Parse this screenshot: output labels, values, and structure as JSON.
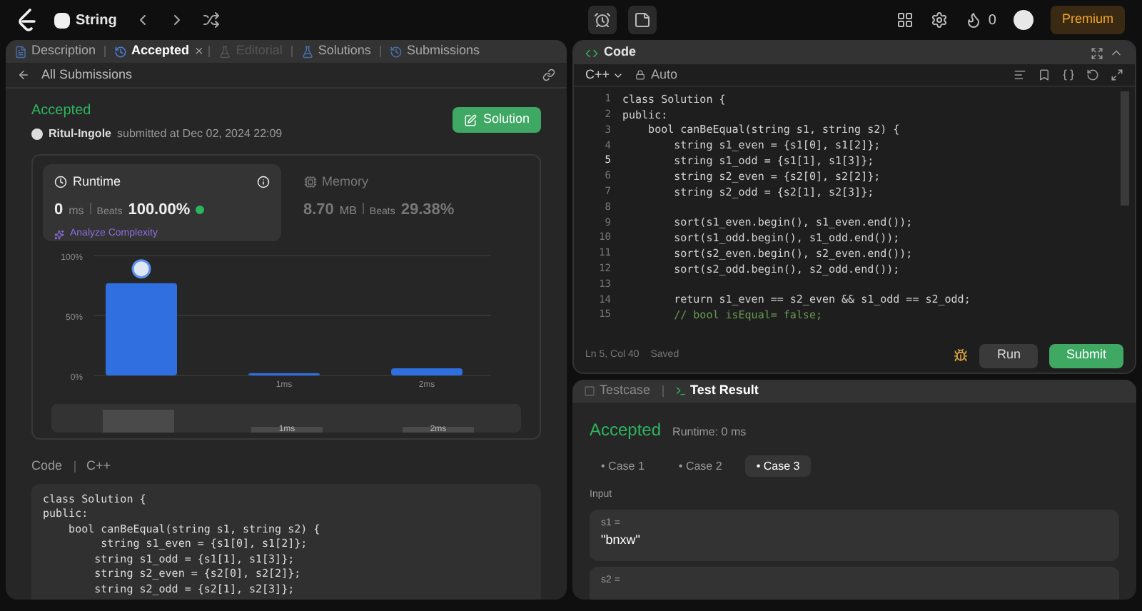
{
  "topbar": {
    "problem_list": "String",
    "flame_count": "0",
    "premium": "Premium"
  },
  "left_tabs": [
    {
      "label": "Description",
      "selected": false,
      "disabled": false
    },
    {
      "label": "Accepted",
      "selected": true,
      "disabled": false,
      "close": "×"
    },
    {
      "label": "Editorial",
      "selected": false,
      "disabled": true
    },
    {
      "label": "Solutions",
      "selected": false,
      "disabled": false
    },
    {
      "label": "Submissions",
      "selected": false,
      "disabled": false
    }
  ],
  "submission": {
    "back": "All Submissions",
    "status": "Accepted",
    "user": "Ritul-Ingole",
    "submitted": "submitted at Dec 02, 2024 22:09",
    "solution_button": "Solution"
  },
  "metrics": [
    {
      "kind": "runtime",
      "title": "Runtime",
      "value": "0",
      "unit": "ms",
      "beats_label": "Beats",
      "beats": "100.00%",
      "selected": true,
      "link": "Analyze Complexity"
    },
    {
      "kind": "memory",
      "title": "Memory",
      "value": "8.70",
      "unit": "MB",
      "beats_label": "Beats",
      "beats": "29.38%",
      "selected": false
    }
  ],
  "chart_data": {
    "type": "bar",
    "categories": [
      null,
      "1ms",
      "2ms"
    ],
    "values": [
      77,
      2,
      6
    ],
    "ylim": [
      0,
      100
    ],
    "yticks": [
      {
        "value": 0,
        "label": "0%"
      },
      {
        "value": 50,
        "label": "50%"
      },
      {
        "value": 100,
        "label": "100%"
      }
    ]
  },
  "navigator": {
    "labels": [
      "1ms",
      "2ms"
    ]
  },
  "code_preview": {
    "label": "Code",
    "language": "C++",
    "lines": [
      "class Solution {",
      "public:",
      "    bool canBeEqual(string s1, string s2) {",
      "         string s1_even = {s1[0], s1[2]};",
      "        string s1_odd = {s1[1], s1[3]};",
      "        string s2_even = {s2[0], s2[2]};",
      "        string s2_odd = {s2[1], s2[3]};"
    ]
  },
  "editor": {
    "title": "Code",
    "language": "C++",
    "mode": "Auto",
    "status": "Ln 5, Col 40",
    "saved": "Saved",
    "run": "Run",
    "submit": "Submit",
    "lines": [
      {
        "n": "1",
        "text": "class Solution {",
        "current": false,
        "kind": "code"
      },
      {
        "n": "2",
        "text": "public:",
        "current": false,
        "kind": "code"
      },
      {
        "n": "3",
        "text": "    bool canBeEqual(string s1, string s2) {",
        "current": false,
        "kind": "code"
      },
      {
        "n": "4",
        "text": "        string s1_even = {s1[0], s1[2]};",
        "current": false,
        "kind": "code"
      },
      {
        "n": "5",
        "text": "        string s1_odd = {s1[1], s1[3]};",
        "current": true,
        "kind": "code"
      },
      {
        "n": "6",
        "text": "        string s2_even = {s2[0], s2[2]};",
        "current": false,
        "kind": "code"
      },
      {
        "n": "7",
        "text": "        string s2_odd = {s2[1], s2[3]};",
        "current": false,
        "kind": "code"
      },
      {
        "n": "8",
        "current": false
      },
      {
        "n": "9",
        "text": "        sort(s1_even.begin(), s1_even.end());",
        "current": false,
        "kind": "code"
      },
      {
        "n": "10",
        "text": "        sort(s1_odd.begin(), s1_odd.end());",
        "current": false,
        "kind": "code"
      },
      {
        "n": "11",
        "text": "        sort(s2_even.begin(), s2_even.end());",
        "current": false,
        "kind": "code"
      },
      {
        "n": "12",
        "text": "        sort(s2_odd.begin(), s2_odd.end());",
        "current": false,
        "kind": "code"
      },
      {
        "n": "13",
        "current": false
      },
      {
        "n": "14",
        "text": "        return s1_even == s2_even && s1_odd == s2_odd;",
        "current": false,
        "kind": "code"
      },
      {
        "n": "15",
        "text": "        // bool isEqual= false;",
        "current": false,
        "kind": "comment"
      }
    ]
  },
  "result_tabs": [
    {
      "label": "Testcase",
      "selected": false
    },
    {
      "label": "Test Result",
      "selected": true
    }
  ],
  "result": {
    "status": "Accepted",
    "runtime": "Runtime: 0 ms",
    "input_label": "Input",
    "cases": [
      {
        "marker": "•",
        "label": "Case 1",
        "selected": false
      },
      {
        "marker": "•",
        "label": "Case 2",
        "selected": false
      },
      {
        "marker": "•",
        "label": "Case 3",
        "selected": true
      }
    ],
    "inputs": [
      {
        "name": "s1 =",
        "value": "\"bnxw\""
      },
      {
        "name": "s2 ="
      }
    ]
  }
}
